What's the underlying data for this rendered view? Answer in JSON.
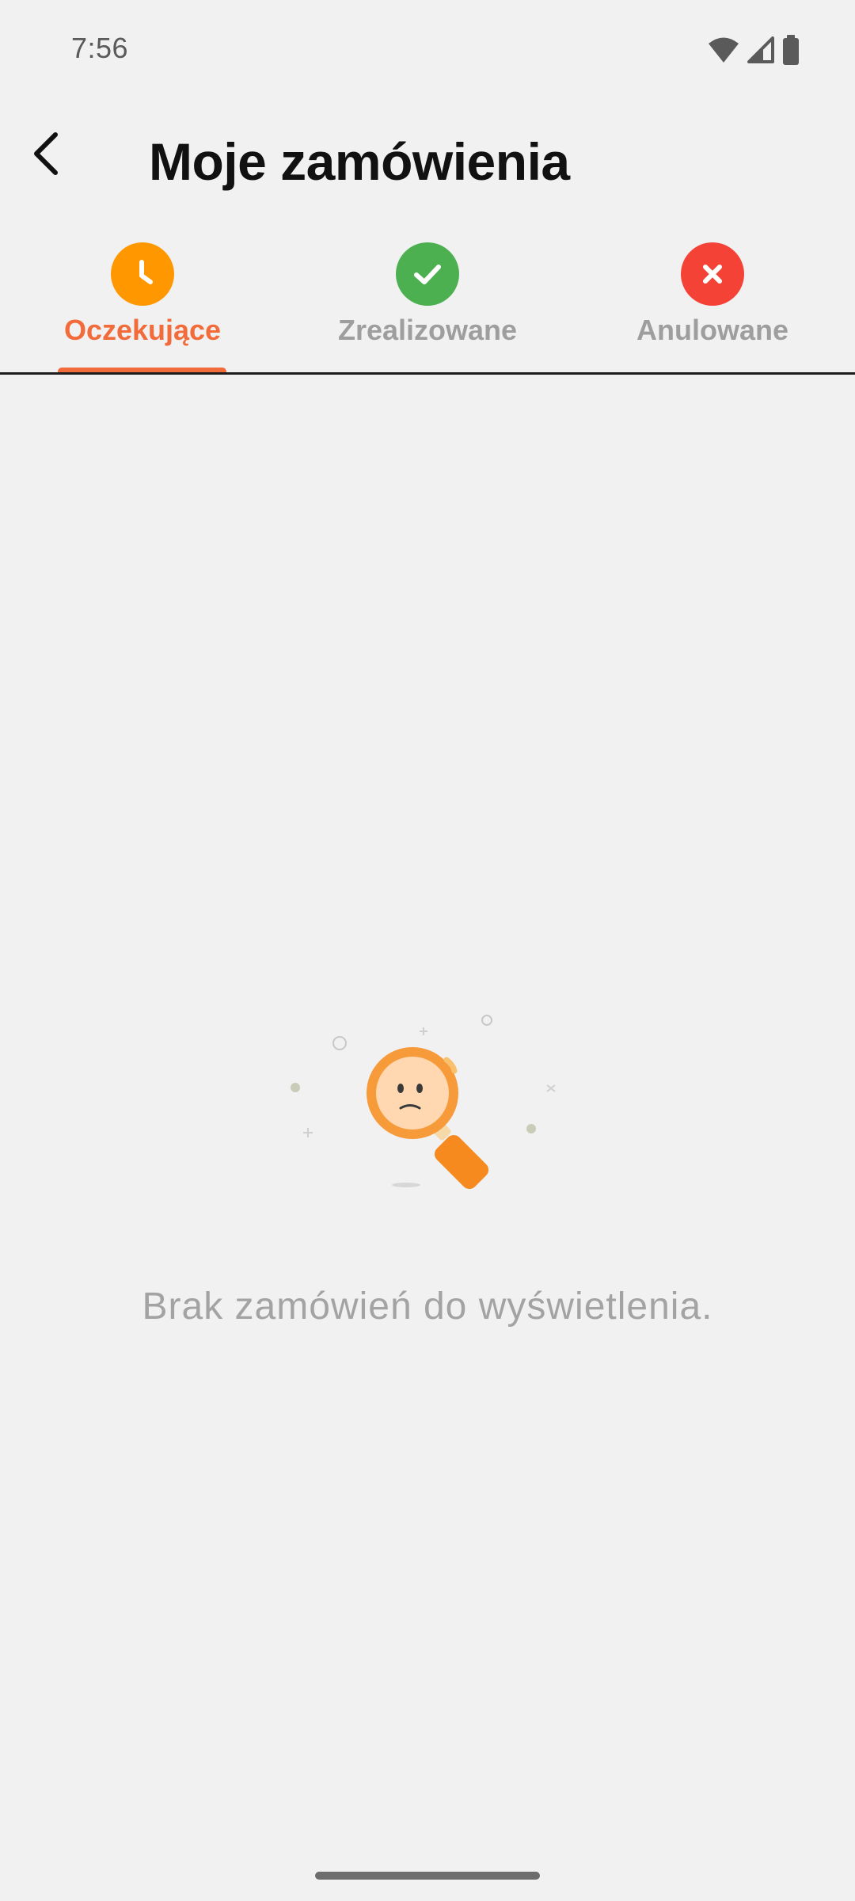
{
  "status_bar": {
    "time": "7:56",
    "icons": [
      "wifi-icon",
      "cell-signal-icon",
      "battery-icon"
    ]
  },
  "app_bar": {
    "back_icon": "arrow-back-icon",
    "title": "Moje zamówienia"
  },
  "tabs": [
    {
      "label": "Oczekujące",
      "icon": "clock-icon",
      "icon_color": "#ff9800",
      "active": true
    },
    {
      "label": "Zrealizowane",
      "icon": "check-icon",
      "icon_color": "#4caf50",
      "active": false
    },
    {
      "label": "Anulowane",
      "icon": "close-icon",
      "icon_color": "#f44336",
      "active": false
    }
  ],
  "empty_state": {
    "illustration": "sad-magnifier-icon",
    "message": "Brak zamówień do wyświetlenia."
  },
  "colors": {
    "accent": "#f26b3a",
    "background": "#f1f1f1",
    "inactive_tab": "#9e9e9e"
  }
}
